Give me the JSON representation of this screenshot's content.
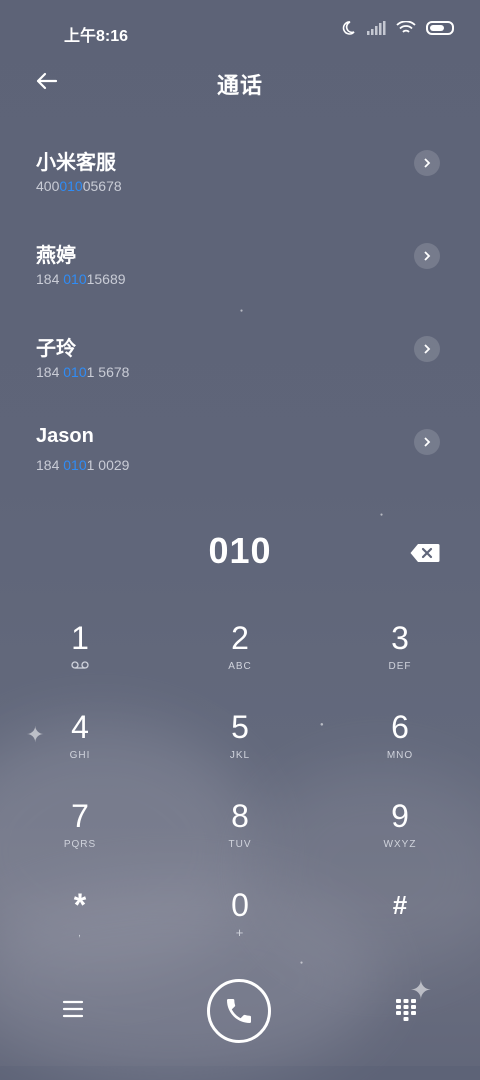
{
  "status_bar": {
    "time": "上午8:16"
  },
  "header": {
    "title": "通话"
  },
  "results": [
    {
      "name": "小米客服",
      "num_pre": "400",
      "num_hl": "010",
      "num_post": "05678"
    },
    {
      "name": "燕婷",
      "num_pre": "184 ",
      "num_hl": "010",
      "num_post": "15689"
    },
    {
      "name": "子玲",
      "num_pre": "184 ",
      "num_hl": "010",
      "num_post": "1 5678"
    },
    {
      "name": "Jason",
      "num_pre": "184 ",
      "num_hl": "010",
      "num_post": "1 0029"
    }
  ],
  "dial_input": "010",
  "keypad": [
    {
      "digit": "1",
      "letters": ""
    },
    {
      "digit": "2",
      "letters": "ABC"
    },
    {
      "digit": "3",
      "letters": "DEF"
    },
    {
      "digit": "4",
      "letters": "GHI"
    },
    {
      "digit": "5",
      "letters": "JKL"
    },
    {
      "digit": "6",
      "letters": "MNO"
    },
    {
      "digit": "7",
      "letters": "PQRS"
    },
    {
      "digit": "8",
      "letters": "TUV"
    },
    {
      "digit": "9",
      "letters": "WXYZ"
    },
    {
      "digit": "*",
      "letters": ","
    },
    {
      "digit": "0",
      "letters": "+"
    },
    {
      "digit": "#",
      "letters": ""
    }
  ],
  "icons": {
    "back": "arrow-left-icon",
    "moon": "moon-icon",
    "signal": "signal-icon",
    "wifi": "wifi-icon",
    "battery": "battery-icon",
    "voicemail": "voicemail-icon",
    "delete": "backspace-icon",
    "menu": "menu-icon",
    "call": "phone-icon",
    "dialpad": "dialpad-icon"
  },
  "colors": {
    "highlight": "#2f8cf5",
    "background": "#5f6579"
  }
}
